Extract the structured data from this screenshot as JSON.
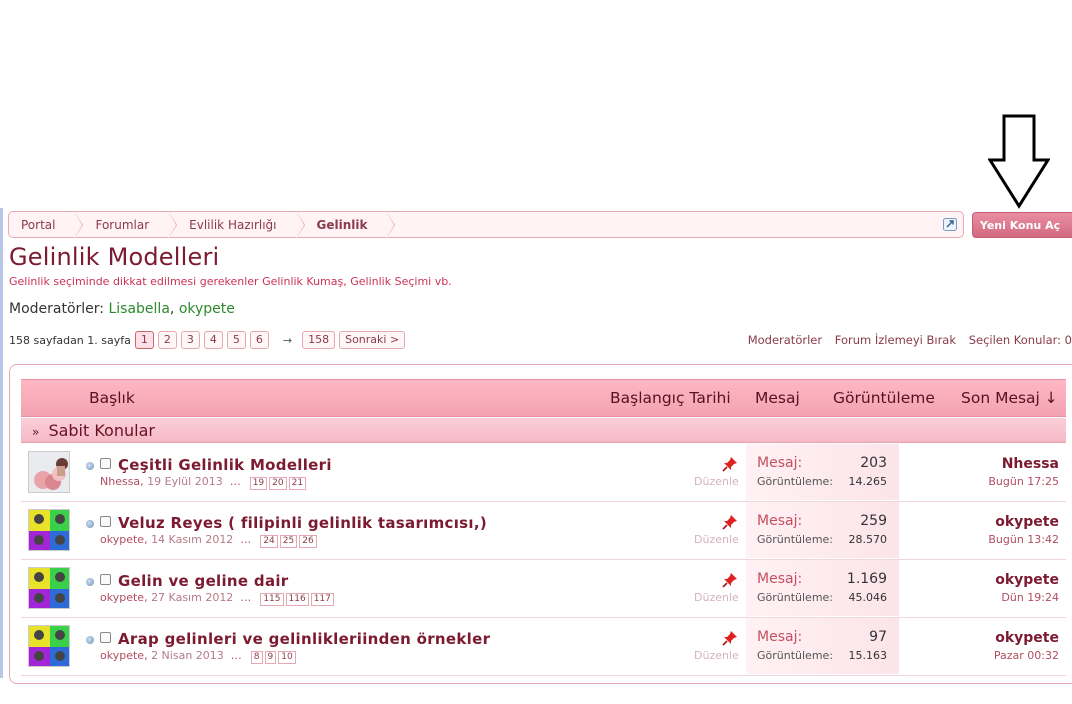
{
  "breadcrumb": [
    "Portal",
    "Forumlar",
    "Evlilik Hazırlığı",
    "Gelinlik"
  ],
  "new_thread_label": "Yeni Konu Aç",
  "forum": {
    "title": "Gelinlik Modelleri",
    "description": "Gelinlik seçiminde dikkat edilmesi gerekenler Gelinlik Kumaş, Gelinlik Seçimi vb.",
    "moderators_label": "Moderatörler:",
    "moderators": [
      "Lisabella",
      "okypete"
    ]
  },
  "pagination": {
    "label": "158 sayfadan 1. sayfa",
    "pages": [
      "1",
      "2",
      "3",
      "4",
      "5",
      "6"
    ],
    "current": "1",
    "arrow": "→",
    "last": "158",
    "next": "Sonraki >"
  },
  "toolbar_links": [
    "Moderatörler",
    "Forum İzlemeyi Bırak",
    "Seçilen Konular: 0"
  ],
  "columns": {
    "title": "Başlık",
    "start_date": "Başlangıç Tarihi",
    "replies": "Mesaj",
    "views": "Görüntüleme",
    "last_post": "Son Mesaj ↓"
  },
  "sticky_label": "Sabit Konular",
  "stat_labels": {
    "replies": "Mesaj:",
    "views": "Görüntüleme:"
  },
  "edit_label": "Düzenle",
  "threads": [
    {
      "title": "Çeşitli Gelinlik Modelleri",
      "author": "Nhessa",
      "date": "19 Eylül 2013",
      "pages": [
        "19",
        "20",
        "21"
      ],
      "replies": "203",
      "views": "14.265",
      "last_user": "Nhessa",
      "last_time": "Bugün 17:25"
    },
    {
      "title": "Veluz Reyes ( filipinli gelinlik tasarımcısı,)",
      "author": "okypete",
      "date": "14 Kasım 2012",
      "pages": [
        "24",
        "25",
        "26"
      ],
      "replies": "259",
      "views": "28.570",
      "last_user": "okypete",
      "last_time": "Bugün 13:42"
    },
    {
      "title": "Gelin ve geline dair",
      "author": "okypete",
      "date": "27 Kasım 2012",
      "pages": [
        "115",
        "116",
        "117"
      ],
      "replies": "1.169",
      "views": "45.046",
      "last_user": "okypete",
      "last_time": "Dün 19:24"
    },
    {
      "title": "Arap gelinleri ve gelinlikleriinden örnekler",
      "author": "okypete",
      "date": "2 Nisan 2013",
      "pages": [
        "8",
        "9",
        "10"
      ],
      "replies": "97",
      "views": "15.163",
      "last_user": "okypete",
      "last_time": "Pazar 00:32"
    }
  ]
}
